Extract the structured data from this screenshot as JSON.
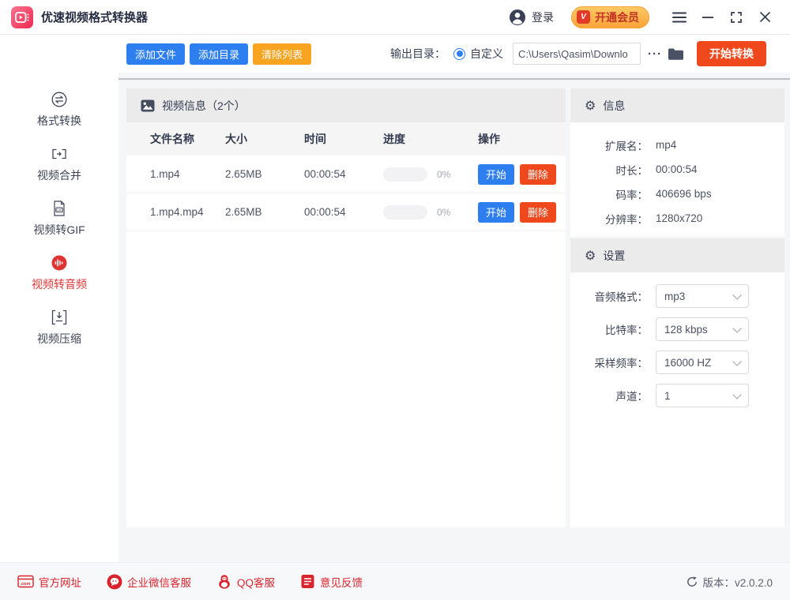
{
  "titlebar": {
    "title": "优速视频格式转换器",
    "login": "登录",
    "vip": "开通会员",
    "vip_badge": "V"
  },
  "toolbar": {
    "add_file": "添加文件",
    "add_dir": "添加目录",
    "clear_list": "清除列表",
    "output_label": "输出目录：",
    "custom": "自定义",
    "path": "C:\\Users\\Qasim\\Downlo",
    "more": "···",
    "start": "开始转换"
  },
  "sidebar": {
    "items": [
      {
        "label": "格式转换",
        "icon": "format-convert-icon"
      },
      {
        "label": "视频合并",
        "icon": "video-merge-icon"
      },
      {
        "label": "视频转GIF",
        "icon": "video-to-gif-icon"
      },
      {
        "label": "视频转音频",
        "icon": "video-to-audio-icon"
      },
      {
        "label": "视频压缩",
        "icon": "video-compress-icon"
      }
    ]
  },
  "table": {
    "title": "视频信息（2个）",
    "columns": [
      "文件名称",
      "大小",
      "时间",
      "进度",
      "操作"
    ],
    "rows": [
      {
        "name": "1.mp4",
        "size": "2.65MB",
        "time": "00:00:54",
        "progress": "0%",
        "start": "开始",
        "remove": "删除"
      },
      {
        "name": "1.mp4.mp4",
        "size": "2.65MB",
        "time": "00:00:54",
        "progress": "0%",
        "start": "开始",
        "remove": "删除"
      }
    ]
  },
  "info": {
    "title": "信息",
    "rows": [
      {
        "label": "扩展名：",
        "value": "mp4"
      },
      {
        "label": "时长：",
        "value": "00:00:54"
      },
      {
        "label": "码率：",
        "value": "406696 bps"
      },
      {
        "label": "分辨率：",
        "value": "1280x720"
      }
    ]
  },
  "settings": {
    "title": "设置",
    "rows": [
      {
        "label": "音频格式：",
        "value": "mp3"
      },
      {
        "label": "比特率：",
        "value": "128 kbps"
      },
      {
        "label": "采样频率：",
        "value": "16000 HZ"
      },
      {
        "label": "声道：",
        "value": "1"
      }
    ]
  },
  "footer": {
    "links": [
      {
        "label": "官方网址",
        "icon": "website-icon"
      },
      {
        "label": "企业微信客服",
        "icon": "wechat-service-icon"
      },
      {
        "label": "QQ客服",
        "icon": "qq-icon"
      },
      {
        "label": "意见反馈",
        "icon": "feedback-icon"
      }
    ],
    "version": "版本：v2.0.2.0"
  },
  "colors": {
    "blue": "#2d7ff0",
    "orange": "#f9a420",
    "red": "#f0481d",
    "active": "#e03434",
    "footer_red": "#d9242e"
  }
}
